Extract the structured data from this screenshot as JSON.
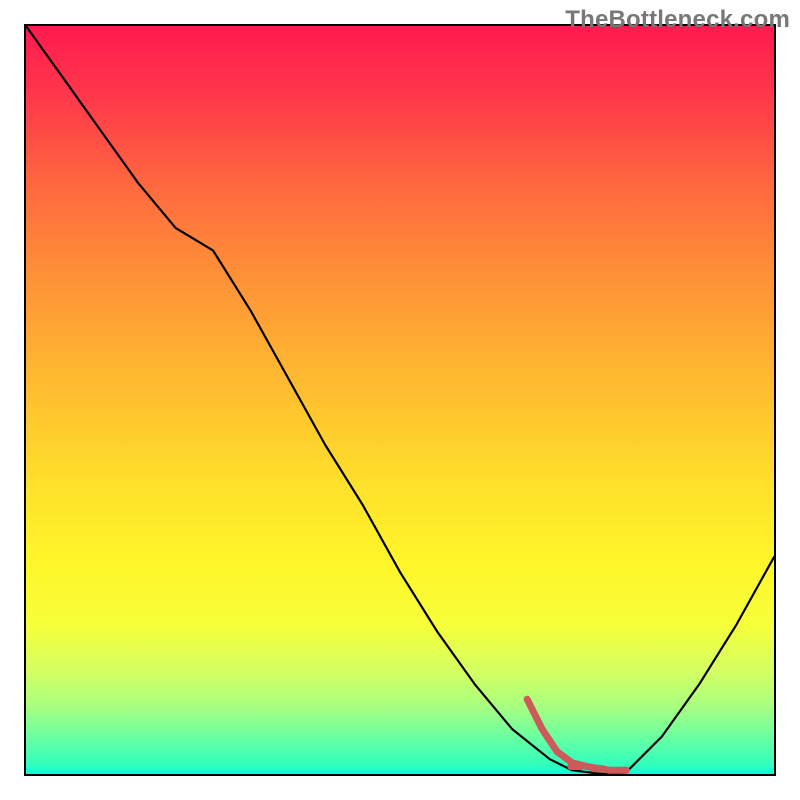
{
  "watermark": "TheBottleneck.com",
  "chart_data": {
    "type": "line",
    "title": "",
    "xlabel": "",
    "ylabel": "",
    "x": [
      0.0,
      0.05,
      0.1,
      0.15,
      0.2,
      0.25,
      0.3,
      0.35,
      0.4,
      0.45,
      0.5,
      0.55,
      0.6,
      0.65,
      0.7,
      0.73,
      0.77,
      0.8,
      0.85,
      0.9,
      0.95,
      1.0
    ],
    "series": [
      {
        "name": "curve",
        "values": [
          1.0,
          0.93,
          0.86,
          0.79,
          0.73,
          0.7,
          0.62,
          0.53,
          0.44,
          0.36,
          0.27,
          0.19,
          0.12,
          0.06,
          0.02,
          0.005,
          0.0,
          0.0,
          0.05,
          0.12,
          0.2,
          0.29
        ],
        "stroke": "#000000"
      }
    ],
    "accent_segment": {
      "stroke": "#cc5a5a",
      "points": [
        {
          "x": 0.67,
          "y": 0.1
        },
        {
          "x": 0.69,
          "y": 0.06
        },
        {
          "x": 0.71,
          "y": 0.03
        },
        {
          "x": 0.73,
          "y": 0.015
        },
        {
          "x": 0.75,
          "y": 0.01
        },
        {
          "x": 0.78,
          "y": 0.005
        },
        {
          "x": 0.8,
          "y": 0.005
        }
      ],
      "dashes": [
        {
          "x": 0.735,
          "y": 0.01
        },
        {
          "x": 0.765,
          "y": 0.007
        },
        {
          "x": 0.8,
          "y": 0.005
        }
      ]
    },
    "xlim": [
      0,
      1
    ],
    "ylim": [
      0,
      1
    ],
    "grid": false,
    "legend": false,
    "background": "rainbow-vertical-gradient"
  }
}
